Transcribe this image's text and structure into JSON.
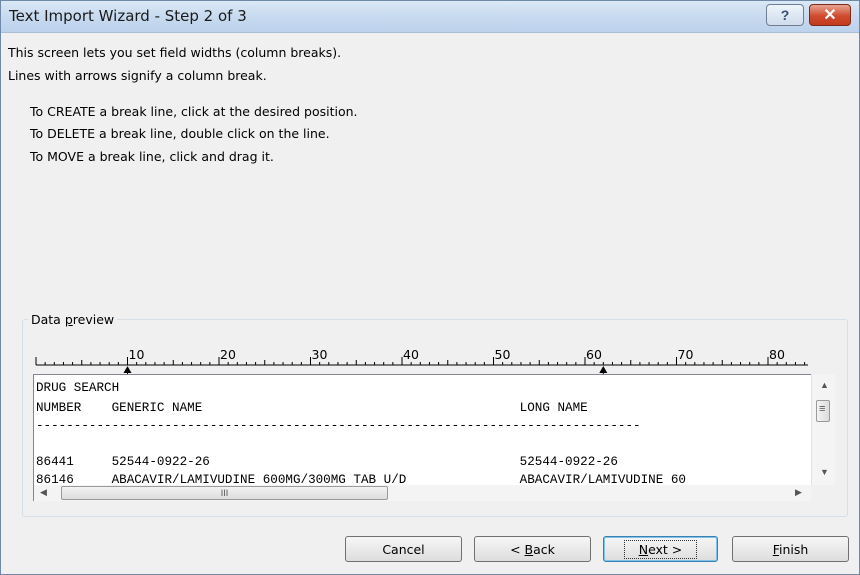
{
  "window": {
    "title": "Text Import Wizard - Step 2 of 3",
    "help_label": "?",
    "close_label": "✕"
  },
  "intro": {
    "line1": "This screen lets you set field widths (column breaks).",
    "line2": "Lines with arrows signify a column break."
  },
  "instructions": {
    "create": "To CREATE a break line, click at the desired position.",
    "delete": "To DELETE a break line, double click on the line.",
    "move": "To MOVE a break line, click and drag it."
  },
  "preview": {
    "group_label_pre": "Data ",
    "group_label_accel": "p",
    "group_label_post": "review",
    "ruler_ticks": [
      "10",
      "20",
      "30",
      "40",
      "50",
      "60",
      "70",
      "80"
    ],
    "column_breaks": [
      10,
      62
    ],
    "lines": [
      "DRUG SEARCH",
      "NUMBER    GENERIC NAME                                          LONG NAME",
      "--------------------------------------------------------------------------------",
      "",
      "86441     52544-0922-26                                         52544-0922-26",
      "86146     ABACAVIR/LAMIVUDINE 600MG/300MG TAB U/D               ABACAVIR/LAMIVUDINE 60"
    ],
    "hscroll_grip": "III"
  },
  "buttons": {
    "cancel": "Cancel",
    "back_pre": "< ",
    "back_accel": "B",
    "back_post": "ack",
    "next_accel": "N",
    "next_post": "ext >",
    "finish_accel": "F",
    "finish_post": "inish"
  },
  "icons": {
    "scroll_up": "▲",
    "scroll_down": "▼",
    "scroll_left": "◀",
    "scroll_right": "▶",
    "grip": "≡"
  }
}
